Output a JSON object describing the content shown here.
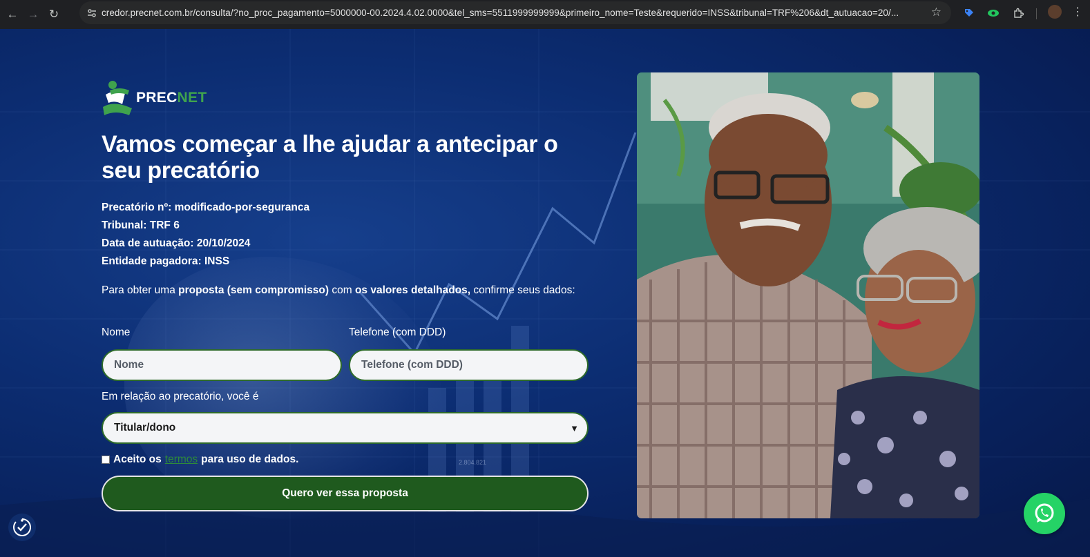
{
  "browser": {
    "url": "credor.precnet.com.br/consulta/?no_proc_pagamento=5000000-00.2024.4.02.0000&tel_sms=5511999999999&primeiro_nome=Teste&requerido=INSS&tribunal=TRF%206&dt_autuacao=20/..."
  },
  "brand": {
    "logo_a": "PREC",
    "logo_b": "NET"
  },
  "headline": "Vamos começar a lhe ajudar a antecipar o seu precatório",
  "details": [
    {
      "label": "Precatório nº:",
      "value": "modificado-por-seguranca"
    },
    {
      "label": "Tribunal:",
      "value": "TRF 6"
    },
    {
      "label": "Data de autuação:",
      "value": "20/10/2024"
    },
    {
      "label": "Entidade pagadora:",
      "value": "INSS"
    }
  ],
  "intro": {
    "p1": "Para obter uma ",
    "b1": "proposta (sem compromisso)",
    "p2": " com ",
    "b2": "os valores detalhados,",
    "p3": " confirme seus dados:"
  },
  "form": {
    "name_label": "Nome",
    "name_placeholder": "Nome",
    "phone_label": "Telefone (com DDD)",
    "phone_placeholder": "Telefone (com DDD)",
    "role_label": "Em relação ao precatório, você é",
    "role_value": "Titular/dono",
    "consent_before": "Aceito os",
    "consent_link": "termos",
    "consent_after": "para uso de dados.",
    "submit": "Quero ver essa proposta"
  },
  "bg_chart_label": "2.804.821",
  "colors": {
    "brand_green": "#1f5a1e",
    "accent_green": "#3fa34d",
    "bg_blue": "#0c2d72",
    "whatsapp": "#25d366"
  }
}
